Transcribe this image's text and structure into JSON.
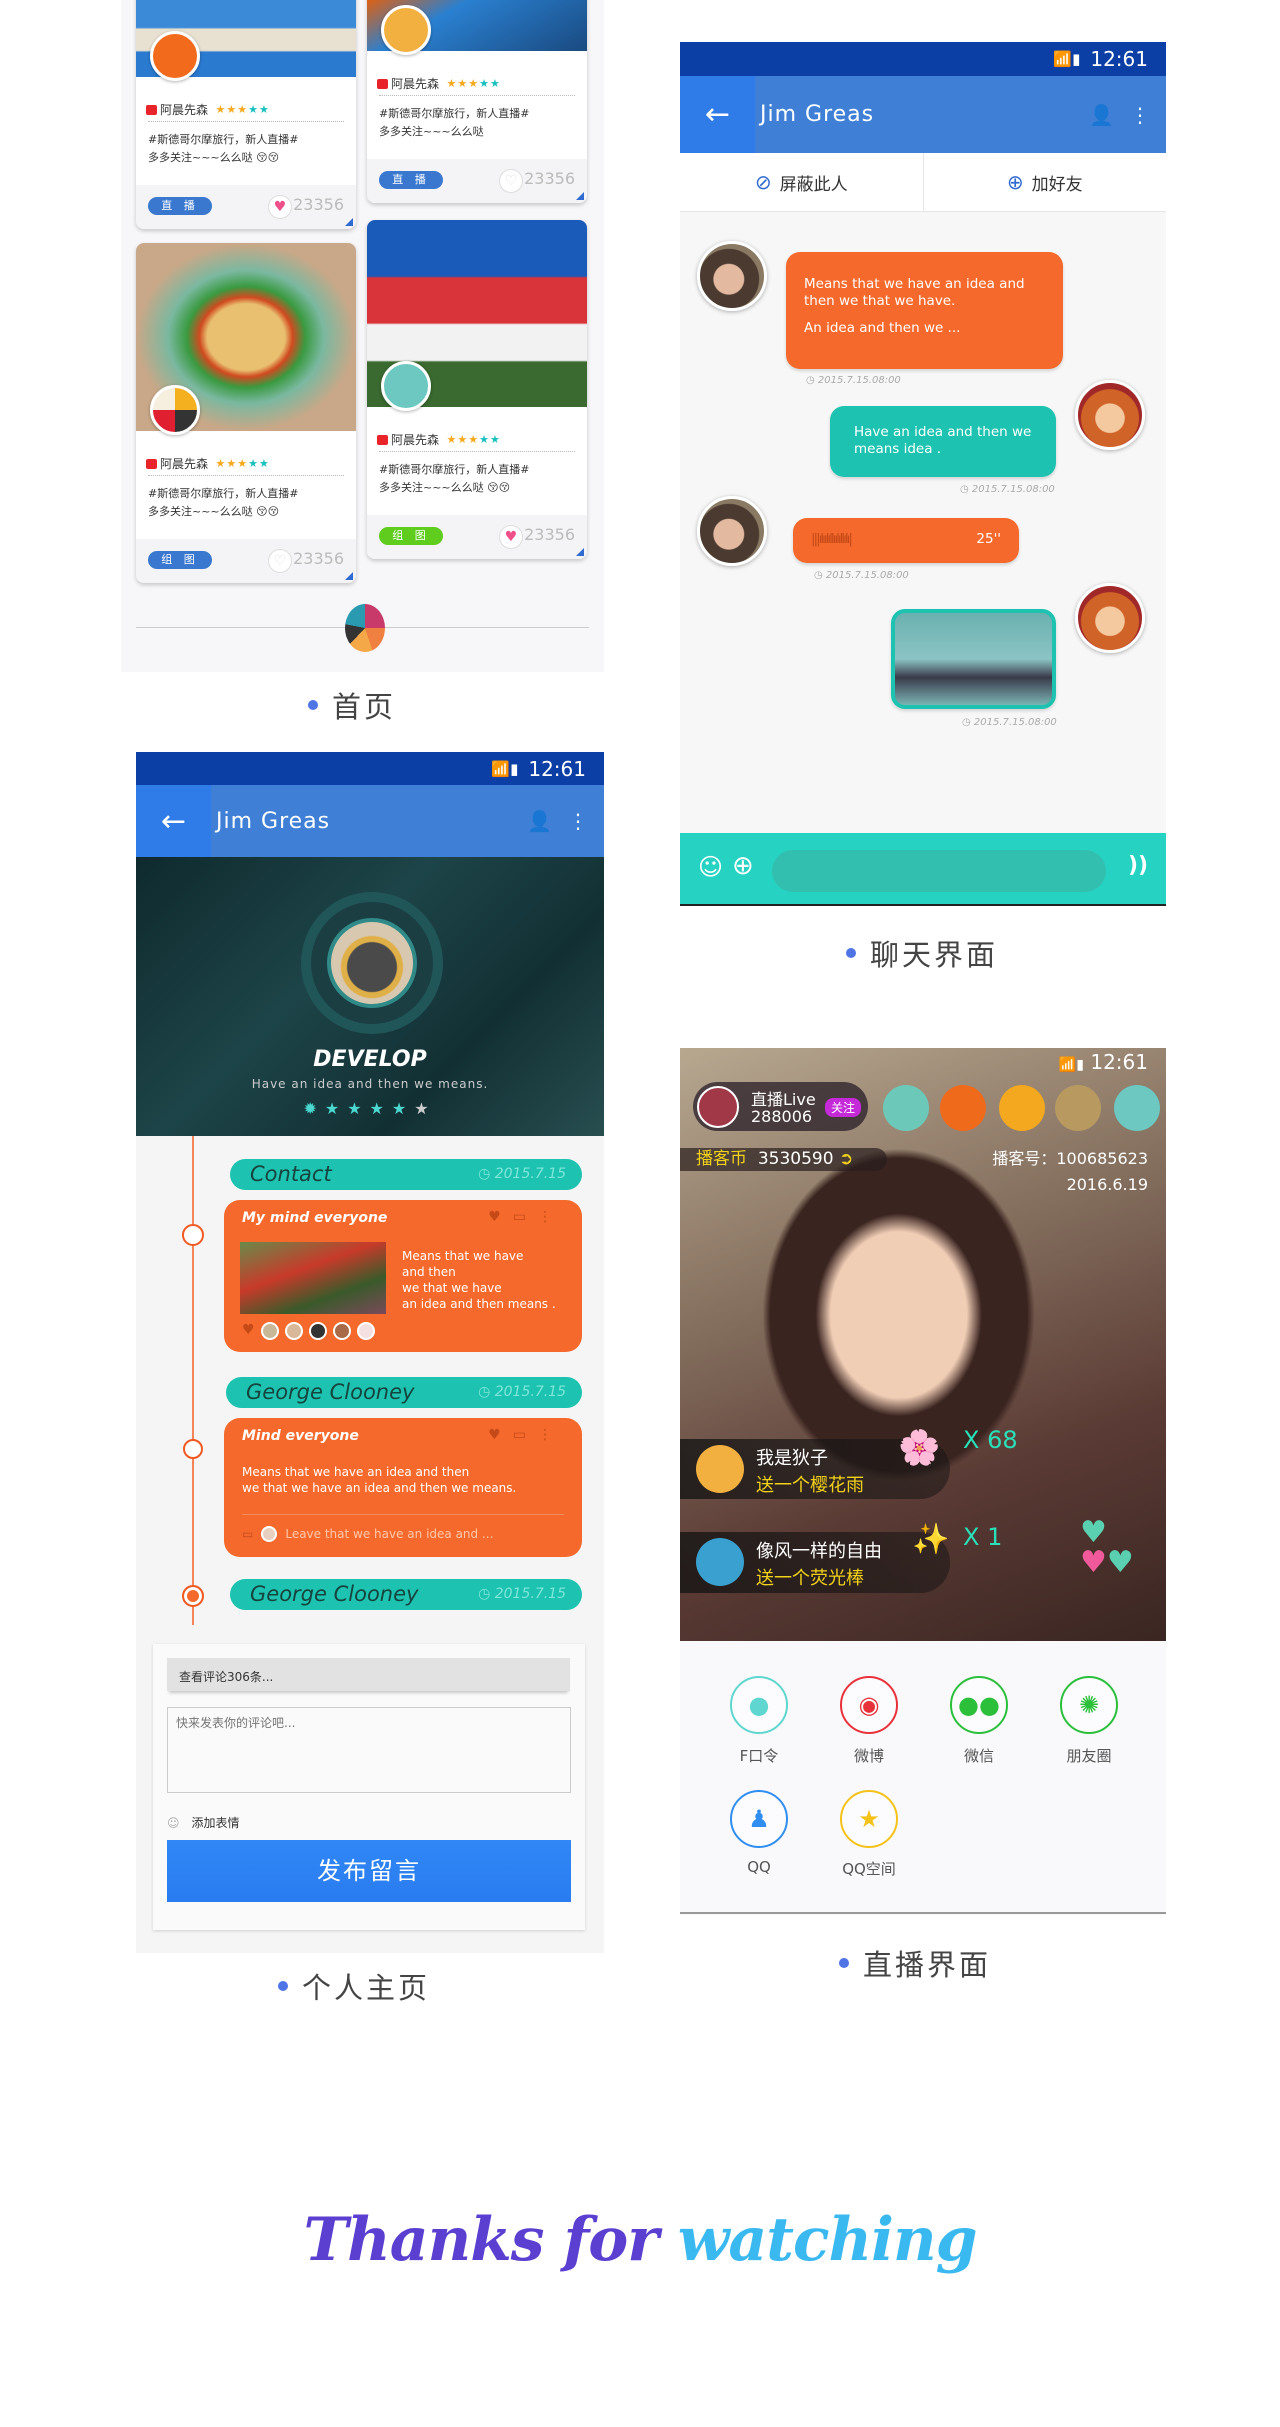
{
  "home": {
    "caption": "首页",
    "cards": [
      {
        "user": "阿晨先森",
        "rating": 5,
        "desc1": "#斯德哥尔摩旅行，新人直播#",
        "desc2": "多多关注~~~么么哒 😚😚",
        "button": "直 播",
        "button_color": "#3a78d0",
        "likes": "23356",
        "liked": true
      },
      {
        "user": "阿晨先森",
        "rating": 5,
        "desc1": "#斯德哥尔摩旅行，新人直播#",
        "desc2": "多多关注~~~么么哒",
        "button": "直 播",
        "button_color": "#3a78d0",
        "likes": "23356",
        "liked": false
      },
      {
        "user": "阿晨先森",
        "rating": 5,
        "desc1": "#斯德哥尔摩旅行，新人直播#",
        "desc2": "多多关注~~~么么哒 😚😚",
        "button": "组 图",
        "button_color": "#3a78d0",
        "likes": "23356",
        "liked": false
      },
      {
        "user": "阿晨先森",
        "rating": 5,
        "desc1": "#斯德哥尔摩旅行，新人直播#",
        "desc2": "多多关注~~~么么哒 😚😚",
        "button": "组 图",
        "button_color": "#5fcc1e",
        "likes": "23356",
        "liked": true
      }
    ]
  },
  "status": {
    "time": "12:61"
  },
  "chat": {
    "caption": "聊天界面",
    "title": "Jim Greas",
    "block_label": "屏蔽此人",
    "add_friend_label": "加好友",
    "messages": [
      {
        "side": "left",
        "type": "text",
        "line1": "Means that we have an idea and",
        "line2": "then we that we have.",
        "line3": "An idea and then we  ...",
        "time": "2015.7.15.08:00"
      },
      {
        "side": "right",
        "type": "text",
        "line1": "Have an idea and then we",
        "line2": "means  idea .",
        "time": "2015.7.15.08:00"
      },
      {
        "side": "left",
        "type": "voice",
        "duration": "25''",
        "time": "2015.7.15.08:00"
      },
      {
        "side": "right",
        "type": "image",
        "time": "2015.7.15.08:00"
      }
    ]
  },
  "profile": {
    "caption": "个人主页",
    "title": "Jim Greas",
    "name": "DEVELOP",
    "tagline": "Have an idea and then we  means.",
    "rating": 5,
    "timeline": [
      {
        "name": "Contact",
        "date": "2015.7.15"
      },
      {
        "name": "George Clooney",
        "date": "2015.7.15"
      },
      {
        "name": "George Clooney",
        "date": "2015.7.15"
      }
    ],
    "post1": {
      "title": "My mind everyone",
      "text": [
        "Means that we have",
        "and then",
        "we that we have",
        "an idea and then means ."
      ]
    },
    "post2": {
      "title": "Mind everyone",
      "text": [
        "Means that we have an idea and then",
        "we that we have an idea and then we  means."
      ],
      "comment": "Leave that we have an idea and ..."
    },
    "view_comments": "查看评论306条...",
    "comment_placeholder": "快来发表你的评论吧...",
    "add_emoji": "添加表情",
    "submit": "发布留言"
  },
  "live": {
    "caption": "直播界面",
    "host_label": "直播Live",
    "host_id": "288006",
    "follow": "关注",
    "coin_label": "播客币",
    "coins": "3530590",
    "account_label": "播客号：100685623",
    "date": "2016.6.19",
    "gifts": [
      {
        "user": "我是狄子",
        "gift": "送一个樱花雨",
        "count": "X 68"
      },
      {
        "user": "像风一样的自由",
        "gift": "送一个荧光棒",
        "count": "X 1"
      }
    ],
    "share": [
      {
        "label": "F口令",
        "color": "#5fd6cf",
        "icon": "owl-icon"
      },
      {
        "label": "微博",
        "color": "#e8323a",
        "icon": "weibo-icon"
      },
      {
        "label": "微信",
        "color": "#2bbf3a",
        "icon": "wechat-icon"
      },
      {
        "label": "朋友圈",
        "color": "#2bbf3a",
        "icon": "moments-icon"
      },
      {
        "label": "QQ",
        "color": "#2f8ef0",
        "icon": "qq-icon"
      },
      {
        "label": "QQ空间",
        "color": "#f5c21a",
        "icon": "qzone-icon"
      }
    ]
  },
  "thanks": {
    "word1": "Thanks for",
    "word2": "watching"
  }
}
